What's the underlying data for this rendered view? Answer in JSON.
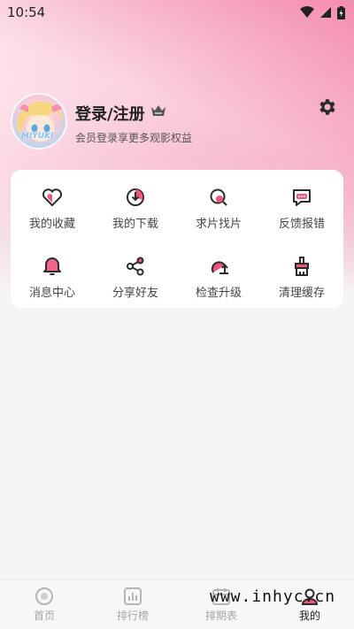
{
  "status_bar": {
    "time": "10:54"
  },
  "profile": {
    "avatar_text": "MIYUKI",
    "title": "登录/注册",
    "subtitle": "会员登录享更多观影权益"
  },
  "menu": {
    "items": [
      {
        "label": "我的收藏",
        "icon": "heart-icon"
      },
      {
        "label": "我的下载",
        "icon": "download-icon"
      },
      {
        "label": "求片找片",
        "icon": "search-film-icon"
      },
      {
        "label": "反馈报错",
        "icon": "feedback-icon"
      },
      {
        "label": "消息中心",
        "icon": "bell-icon"
      },
      {
        "label": "分享好友",
        "icon": "share-icon"
      },
      {
        "label": "检查升级",
        "icon": "upgrade-icon"
      },
      {
        "label": "清理缓存",
        "icon": "broom-icon"
      }
    ]
  },
  "bottom_nav": {
    "items": [
      {
        "label": "首页",
        "active": false
      },
      {
        "label": "排行榜",
        "active": false
      },
      {
        "label": "排期表",
        "active": false
      },
      {
        "label": "我的",
        "active": true
      }
    ]
  },
  "watermark": "www.inhyc.cn",
  "colors": {
    "accent": "#f0567d",
    "icon_dark": "#2b2b2b"
  }
}
